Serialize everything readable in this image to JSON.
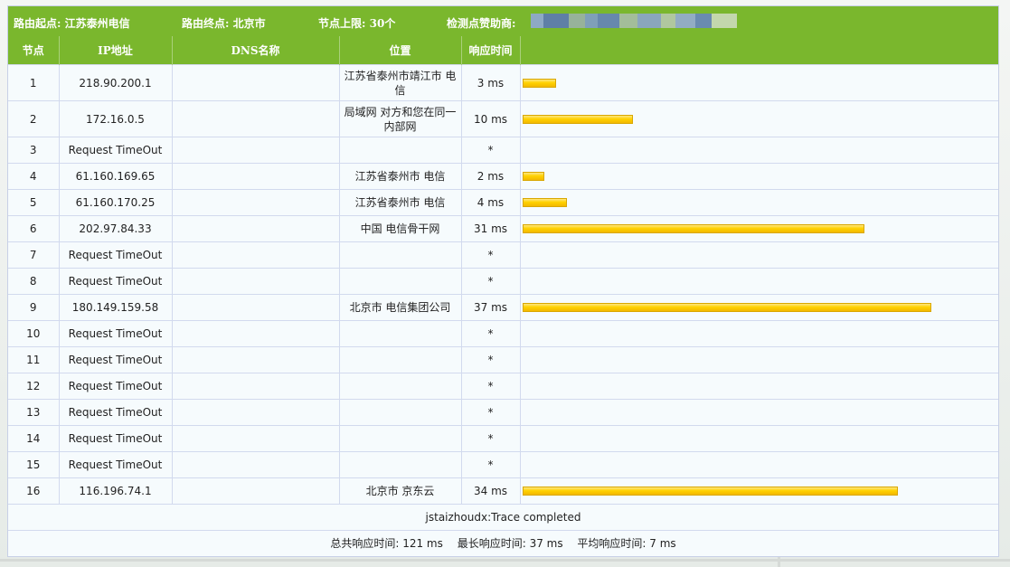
{
  "route": {
    "origin_label": "路由起点:",
    "origin_value": "江苏泰州电信",
    "destination_label": "路由终点:",
    "destination_value": "北京市",
    "hop_limit_label": "节点上限:",
    "hop_limit_value": "30个",
    "sponsor_label": "检测点赞助商:"
  },
  "colors": {
    "header_green": "#7ab72d",
    "bar_yellow": "#ffd200",
    "row_background": "#f6fbfd"
  },
  "table": {
    "headers": {
      "hop": "节点",
      "ip": "IP地址",
      "dns": "DNS名称",
      "location": "位置",
      "response_time": "响应时间",
      "bar": ""
    },
    "max_ms_scale": 43,
    "rows": [
      {
        "hop": "1",
        "ip": "218.90.200.1",
        "dns": "",
        "location": "江苏省泰州市靖江市 电信",
        "time": "3 ms",
        "ms": 3
      },
      {
        "hop": "2",
        "ip": "172.16.0.5",
        "dns": "",
        "location": "局域网 对方和您在同一内部网",
        "time": "10 ms",
        "ms": 10
      },
      {
        "hop": "3",
        "ip": "Request TimeOut",
        "dns": "",
        "location": "",
        "time": "*",
        "ms": null
      },
      {
        "hop": "4",
        "ip": "61.160.169.65",
        "dns": "",
        "location": "江苏省泰州市 电信",
        "time": "2 ms",
        "ms": 2
      },
      {
        "hop": "5",
        "ip": "61.160.170.25",
        "dns": "",
        "location": "江苏省泰州市 电信",
        "time": "4 ms",
        "ms": 4
      },
      {
        "hop": "6",
        "ip": "202.97.84.33",
        "dns": "",
        "location": "中国 电信骨干网",
        "time": "31 ms",
        "ms": 31
      },
      {
        "hop": "7",
        "ip": "Request TimeOut",
        "dns": "",
        "location": "",
        "time": "*",
        "ms": null
      },
      {
        "hop": "8",
        "ip": "Request TimeOut",
        "dns": "",
        "location": "",
        "time": "*",
        "ms": null
      },
      {
        "hop": "9",
        "ip": "180.149.159.58",
        "dns": "",
        "location": "北京市 电信集团公司",
        "time": "37 ms",
        "ms": 37
      },
      {
        "hop": "10",
        "ip": "Request TimeOut",
        "dns": "",
        "location": "",
        "time": "*",
        "ms": null
      },
      {
        "hop": "11",
        "ip": "Request TimeOut",
        "dns": "",
        "location": "",
        "time": "*",
        "ms": null
      },
      {
        "hop": "12",
        "ip": "Request TimeOut",
        "dns": "",
        "location": "",
        "time": "*",
        "ms": null
      },
      {
        "hop": "13",
        "ip": "Request TimeOut",
        "dns": "",
        "location": "",
        "time": "*",
        "ms": null
      },
      {
        "hop": "14",
        "ip": "Request TimeOut",
        "dns": "",
        "location": "",
        "time": "*",
        "ms": null
      },
      {
        "hop": "15",
        "ip": "Request TimeOut",
        "dns": "",
        "location": "",
        "time": "*",
        "ms": null
      },
      {
        "hop": "16",
        "ip": "116.196.74.1",
        "dns": "",
        "location": "北京市 京东云",
        "time": "34 ms",
        "ms": 34
      }
    ]
  },
  "status": {
    "completed_text": "jstaizhoudx:Trace completed"
  },
  "summary": {
    "total_label": "总共响应时间:",
    "total_value": "121 ms",
    "max_label": "最长响应时间:",
    "max_value": "37 ms",
    "avg_label": "平均响应时间:",
    "avg_value": "7 ms"
  }
}
